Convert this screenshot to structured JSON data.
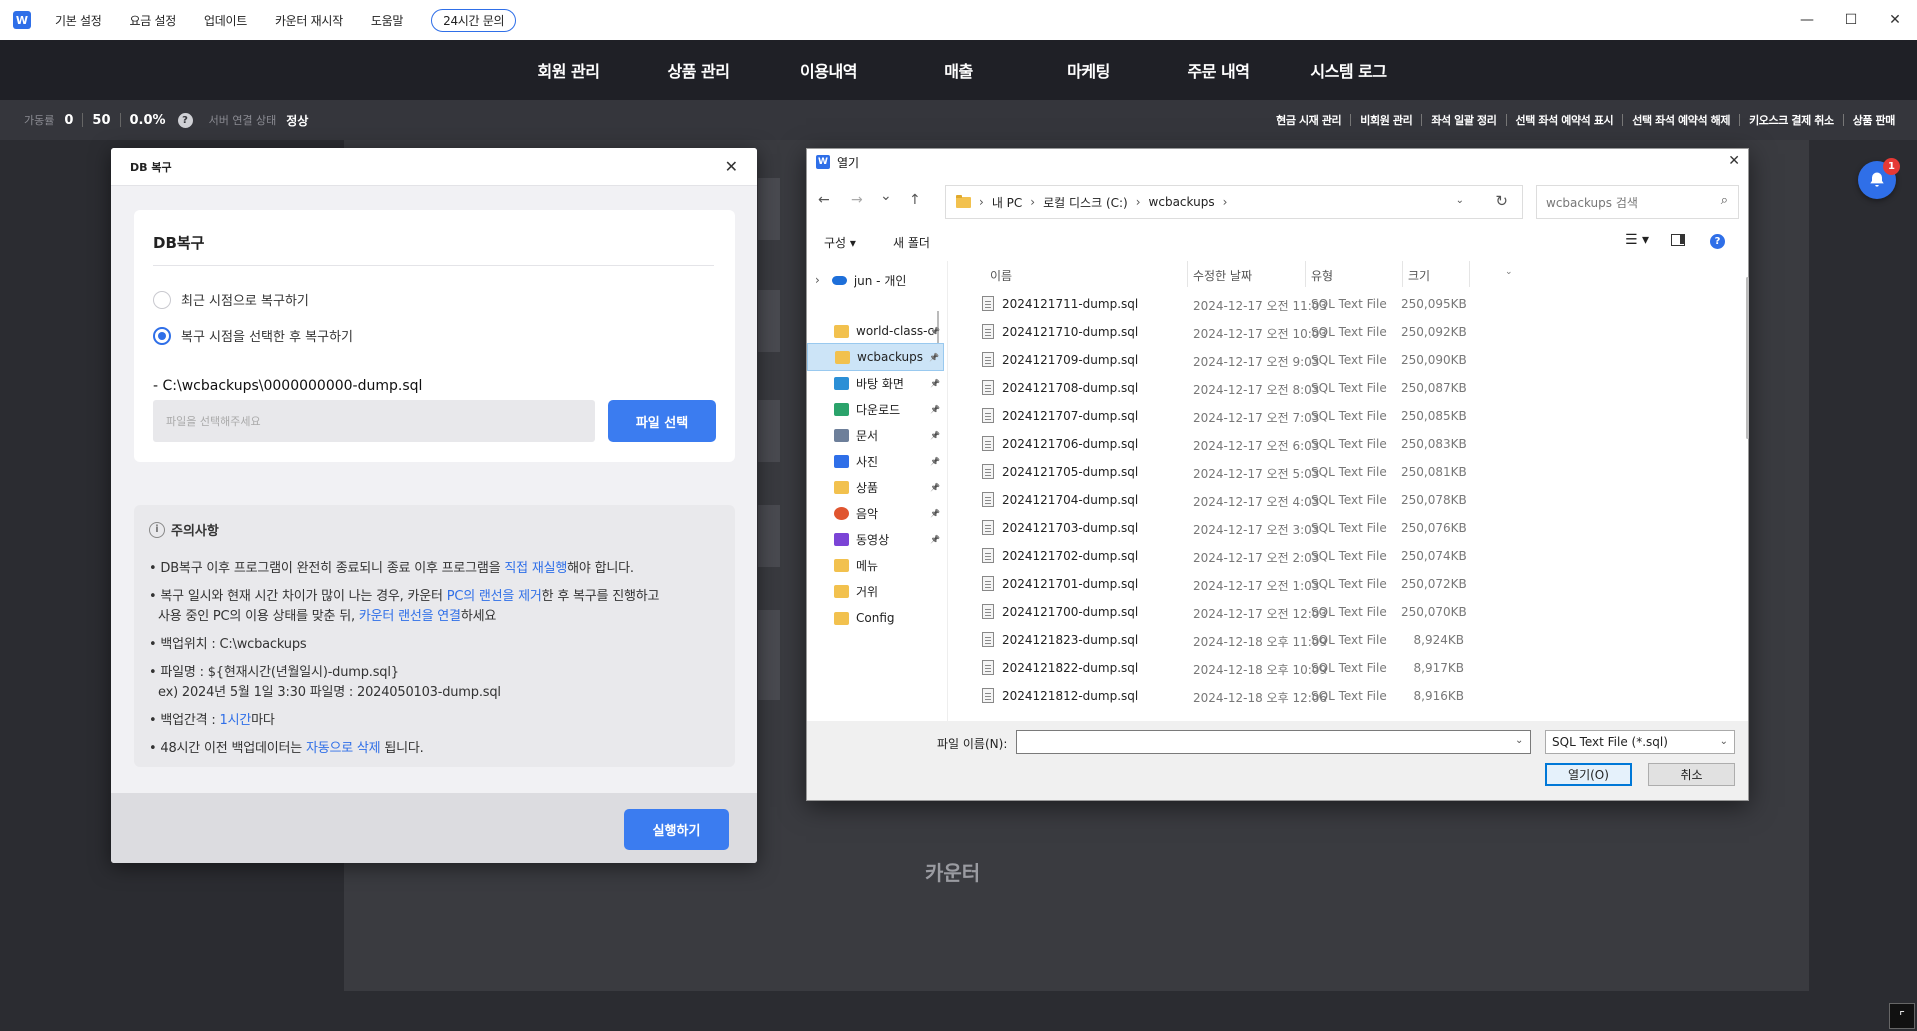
{
  "titlebar": {
    "logo": "W",
    "menu": [
      "기본 설정",
      "요금 설정",
      "업데이트",
      "카운터 재시작",
      "도움말"
    ],
    "support": "24시간 문의",
    "controls": {
      "minimize": "—",
      "maximize": "☐",
      "close": "✕"
    }
  },
  "topnav": [
    "회원 관리",
    "상품 관리",
    "이용내역",
    "매출",
    "마케팅",
    "주문 내역",
    "시스템 로그"
  ],
  "status": {
    "usage_label": "가동률",
    "used": "0",
    "total": "50",
    "percent": "0.0%",
    "help": "?",
    "server_label": "서버 연결 상태",
    "server_value": "정상",
    "actions": [
      "현금 시재 관리",
      "비회원 관리",
      "좌석 일괄 정리",
      "선택 좌석 예약석 표시",
      "선택 좌석 예약석 해제",
      "키오스크 결제 취소",
      "상품 판매"
    ]
  },
  "background": {
    "caption": "카운터",
    "notification_count": "1"
  },
  "db_dialog": {
    "title": "DB 복구",
    "close": "✕",
    "section_title": "DB복구",
    "option_recent": "최근 시점으로 복구하기",
    "option_select": "복구 시점을 선택한 후 복구하기",
    "selected_option": "option_select",
    "path": "- C:\\wcbackups\\0000000000-dump.sql",
    "file_placeholder": "파일을 선택해주세요",
    "file_button": "파일 선택",
    "notice_title": "주의사항",
    "notes": {
      "n1_a": "• DB복구 이후 프로그램이 완전히 종료되니 종료 이후 프로그램을 ",
      "n1_hl": "직접 재실행",
      "n1_b": "해야 합니다.",
      "n2_a": "• 복구 일시와 현재 시간 차이가 많이 나는 경우, 카운터 ",
      "n2_hl1": "PC의 랜선을 제거",
      "n2_b": "한 후 복구를 진행하고",
      "n2_c": "사용 중인 PC의 이용 상태를 맞춘 뒤, ",
      "n2_hl2": "카운터 랜선을 연결",
      "n2_d": "하세요",
      "n3": "• 백업위치 : C:\\wcbackups",
      "n4": "• 파일명 : ${현재시간(년월일시)-dump.sql}",
      "n4_ex": "ex) 2024년 5월 1일 3:30 파일명 : 2024050103-dump.sql",
      "n5_a": "• 백업간격 : ",
      "n5_hl": "1시간",
      "n5_b": "마다",
      "n6_a": "• 48시간 이전 백업데이터는 ",
      "n6_hl": "자동으로 삭제",
      "n6_b": " 됩니다."
    },
    "run_button": "실행하기"
  },
  "open_dialog": {
    "title": "열기",
    "close": "✕",
    "nav": {
      "back": "←",
      "forward": "→",
      "recent": "⌄",
      "up": "↑"
    },
    "breadcrumb": [
      "내 PC",
      "로컬 디스크 (C:)",
      "wcbackups"
    ],
    "search_placeholder": "wcbackups 검색",
    "toolbar": {
      "organize": "구성 ▾",
      "new_folder": "새 폴더"
    },
    "sidebar": [
      {
        "label": "jun - 개인",
        "icon": "onedrive-icon"
      },
      {
        "label": "world-class-c",
        "icon": "folder-icon"
      },
      {
        "label": "wcbackups",
        "icon": "folder-icon",
        "selected": true
      },
      {
        "label": "바탕 화면",
        "icon": "desktop-icon"
      },
      {
        "label": "다운로드",
        "icon": "download-icon"
      },
      {
        "label": "문서",
        "icon": "document-icon"
      },
      {
        "label": "사진",
        "icon": "picture-icon"
      },
      {
        "label": "상품",
        "icon": "folder-icon"
      },
      {
        "label": "음악",
        "icon": "music-icon"
      },
      {
        "label": "동영상",
        "icon": "video-icon"
      },
      {
        "label": "메뉴",
        "icon": "folder-icon"
      },
      {
        "label": "거위",
        "icon": "folder-icon"
      },
      {
        "label": "Config",
        "icon": "folder-icon"
      }
    ],
    "columns": {
      "name": "이름",
      "date": "수정한 날짜",
      "type": "유형",
      "size": "크기"
    },
    "files": [
      {
        "name": "2024121711-dump.sql",
        "date": "2024-12-17 오전 11:03",
        "type": "SQL Text File",
        "size": "250,095KB"
      },
      {
        "name": "2024121710-dump.sql",
        "date": "2024-12-17 오전 10:03",
        "type": "SQL Text File",
        "size": "250,092KB"
      },
      {
        "name": "2024121709-dump.sql",
        "date": "2024-12-17 오전 9:03",
        "type": "SQL Text File",
        "size": "250,090KB"
      },
      {
        "name": "2024121708-dump.sql",
        "date": "2024-12-17 오전 8:03",
        "type": "SQL Text File",
        "size": "250,087KB"
      },
      {
        "name": "2024121707-dump.sql",
        "date": "2024-12-17 오전 7:03",
        "type": "SQL Text File",
        "size": "250,085KB"
      },
      {
        "name": "2024121706-dump.sql",
        "date": "2024-12-17 오전 6:03",
        "type": "SQL Text File",
        "size": "250,083KB"
      },
      {
        "name": "2024121705-dump.sql",
        "date": "2024-12-17 오전 5:03",
        "type": "SQL Text File",
        "size": "250,081KB"
      },
      {
        "name": "2024121704-dump.sql",
        "date": "2024-12-17 오전 4:03",
        "type": "SQL Text File",
        "size": "250,078KB"
      },
      {
        "name": "2024121703-dump.sql",
        "date": "2024-12-17 오전 3:03",
        "type": "SQL Text File",
        "size": "250,076KB"
      },
      {
        "name": "2024121702-dump.sql",
        "date": "2024-12-17 오전 2:03",
        "type": "SQL Text File",
        "size": "250,074KB"
      },
      {
        "name": "2024121701-dump.sql",
        "date": "2024-12-17 오전 1:03",
        "type": "SQL Text File",
        "size": "250,072KB"
      },
      {
        "name": "2024121700-dump.sql",
        "date": "2024-12-17 오전 12:03",
        "type": "SQL Text File",
        "size": "250,070KB"
      },
      {
        "name": "2024121823-dump.sql",
        "date": "2024-12-18 오후 11:09",
        "type": "SQL Text File",
        "size": "8,924KB"
      },
      {
        "name": "2024121822-dump.sql",
        "date": "2024-12-18 오후 10:09",
        "type": "SQL Text File",
        "size": "8,917KB"
      },
      {
        "name": "2024121812-dump.sql",
        "date": "2024-12-18 오후 12:06",
        "type": "SQL Text File",
        "size": "8,916KB"
      }
    ],
    "filename_label": "파일 이름(N):",
    "filename_value": "",
    "filetype": "SQL Text File (*.sql)",
    "open_button": "열기(O)",
    "cancel_button": "취소"
  }
}
